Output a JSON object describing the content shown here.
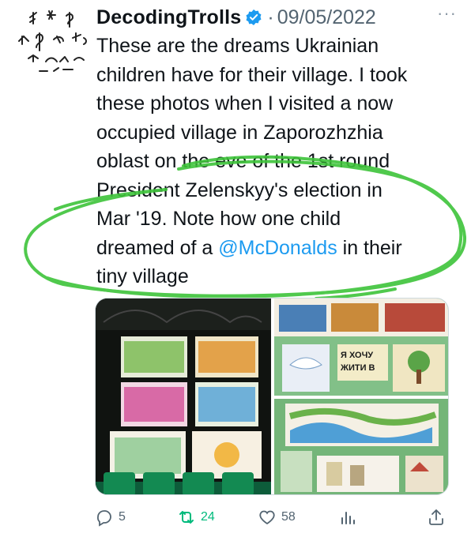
{
  "tweet": {
    "author_name": "DecodingTrolls",
    "separator": "·",
    "date": "09/05/2022",
    "more_label": "···",
    "text_lines": [
      "These are the dreams Ukrainian",
      "children have for their village. I took",
      "these photos when I visited a now",
      "occupied village in Zaporozhzhia",
      "oblast on the eve of the 1st round",
      "President Zelenskyy's election in",
      "Mar '19. Note how one child"
    ],
    "text_before_mention": "dreamed of a ",
    "mention": "@McDonalds",
    "text_after_mention": " in their",
    "text_last_line": "tiny village"
  },
  "media": {
    "photo2_sign_line1": "Я ХОЧУ",
    "photo2_sign_line2": "ЖИТИ В"
  },
  "actions": {
    "replies": "5",
    "retweets": "24",
    "likes": "58"
  },
  "colors": {
    "accent": "#1d9bf0",
    "retweet_green": "#00ba7c",
    "highlight_marker": "#3ec43a",
    "muted": "#536471"
  },
  "icons": [
    "reply-icon",
    "retweet-icon",
    "like-icon",
    "views-icon",
    "share-icon",
    "verified-icon",
    "more-icon"
  ]
}
